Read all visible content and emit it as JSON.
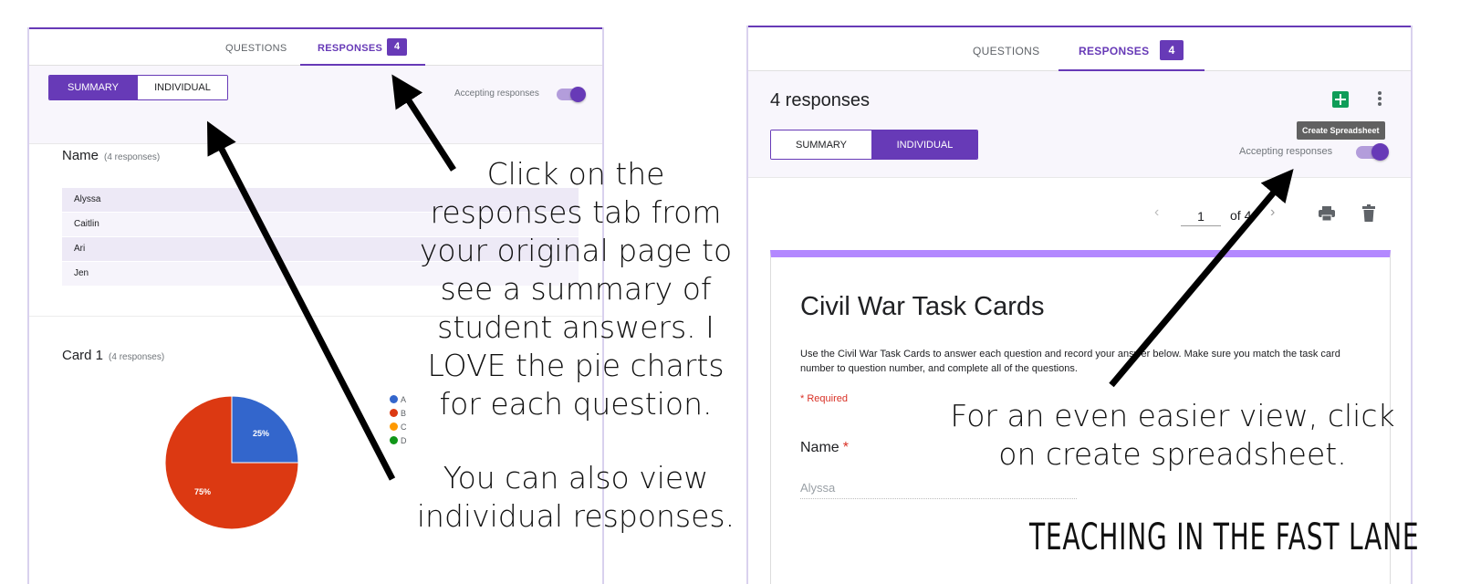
{
  "left_panel": {
    "tabs": {
      "questions": "QUESTIONS",
      "responses": "RESPONSES",
      "badge": "4"
    },
    "view_toggle": {
      "summary": "SUMMARY",
      "individual": "INDIVIDUAL",
      "selected": "SUMMARY"
    },
    "accepting_label": "Accepting responses",
    "accepting_on": true,
    "name_question": {
      "title": "Name",
      "count": "(4 responses)",
      "answers": [
        "Alyssa",
        "Caitlin",
        "Ari",
        "Jen"
      ]
    },
    "card_question": {
      "title": "Card 1",
      "count": "(4 responses)",
      "legend": [
        "A",
        "B",
        "C",
        "D"
      ]
    }
  },
  "chart_data": {
    "type": "pie",
    "categories": [
      "A",
      "B",
      "C",
      "D"
    ],
    "values": [
      25,
      75,
      0,
      0
    ],
    "slice_labels": [
      "25%",
      "75%"
    ],
    "colors": {
      "A": "#3366cc",
      "B": "#dc3912",
      "C": "#ff9900",
      "D": "#109618"
    },
    "legend_position": "right"
  },
  "right_panel": {
    "tabs": {
      "questions": "QUESTIONS",
      "responses": "RESPONSES",
      "badge": "4"
    },
    "responses_heading": "4 responses",
    "view_toggle": {
      "summary": "SUMMARY",
      "individual": "INDIVIDUAL",
      "selected": "INDIVIDUAL"
    },
    "tooltip": "Create Spreadsheet",
    "accepting_label": "Accepting responses",
    "accepting_on": true,
    "pager": {
      "current": "1",
      "total_text": "of 4"
    },
    "form": {
      "title": "Civil War Task Cards",
      "description": "Use the Civil War Task Cards to answer each question and record your answer below. Make sure you match the task card number to question number, and complete all of the questions.",
      "required_note": "* Required",
      "field_label": "Name",
      "field_required_mark": "*",
      "field_value": "Alyssa"
    }
  },
  "annotations": {
    "caption_main": [
      "Click on the",
      "responses tab from",
      "your original page to",
      "see a summary of",
      "student answers. I",
      "LOVE the pie charts",
      "for each question."
    ],
    "caption_individual": [
      "You can also view",
      "individual responses."
    ],
    "caption_spreadsheet": [
      "For an even easier view, click",
      "on create spreadsheet."
    ],
    "brand": "TEACHING IN THE FAST LANE"
  },
  "colors": {
    "accent": "#673ab7",
    "accent_light": "#b388ff",
    "sheets_green": "#0f9d58"
  }
}
